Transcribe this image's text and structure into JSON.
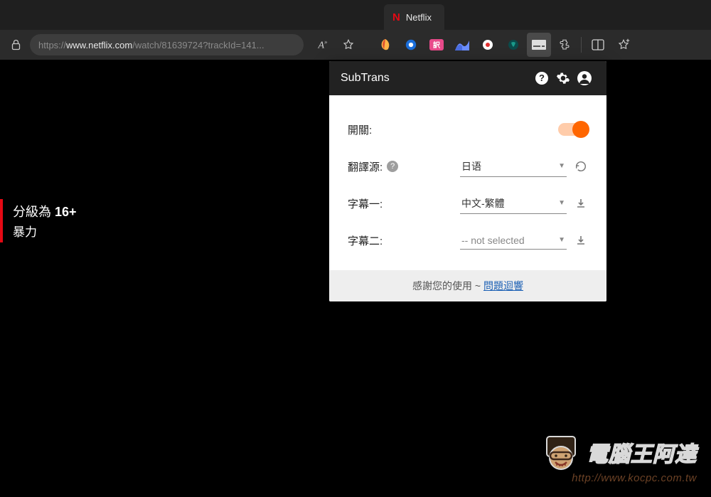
{
  "tab": {
    "title": "Netflix"
  },
  "url": {
    "scheme": "https://",
    "sub": "www.",
    "host": "netflix.com",
    "path": "/watch/81639724?trackId=141..."
  },
  "rating": {
    "prefix": "分級為 ",
    "level": "16+",
    "reason": "暴力"
  },
  "popup": {
    "title": "SubTrans",
    "switch_label": "開關:",
    "source_label": "翻譯源:",
    "source_value": "日语",
    "sub1_label": "字幕一:",
    "sub1_value": "中文-繁體",
    "sub2_label": "字幕二:",
    "sub2_value": "-- not selected",
    "footer_text": "感謝您的使用 ~ ",
    "footer_link": "問題迴響"
  },
  "watermark": {
    "text": "電腦王阿達",
    "url": "http://www.kocpc.com.tw"
  }
}
